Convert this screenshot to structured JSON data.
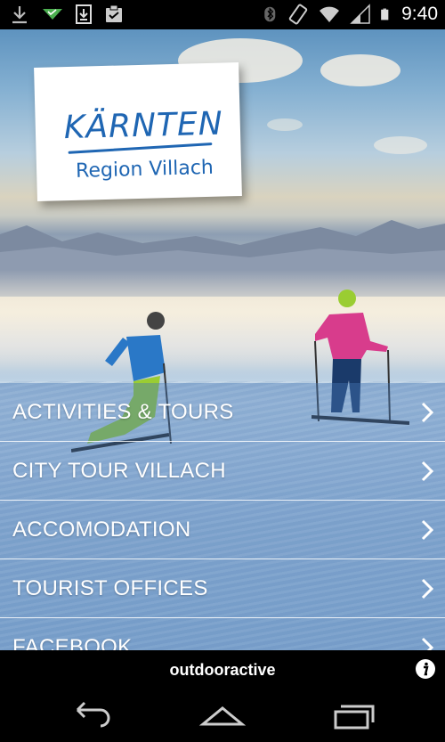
{
  "status_bar": {
    "time": "9:40",
    "left_icons": [
      "download-icon",
      "signal-check-icon",
      "download-box-icon",
      "clipboard-icon"
    ],
    "right_icons": [
      "bluetooth-icon",
      "rotate-icon",
      "wifi-icon",
      "cell-signal-icon",
      "battery-icon"
    ]
  },
  "logo": {
    "title": "KÄRNTEN",
    "subtitle": "Region Villach",
    "color": "#1f66b3"
  },
  "menu": {
    "items": [
      {
        "label": "ACTIVITIES & TOURS",
        "icon": "chevron-right-icon"
      },
      {
        "label": "CITY TOUR VILLACH",
        "icon": "chevron-right-icon"
      },
      {
        "label": "ACCOMODATION",
        "icon": "chevron-right-icon"
      },
      {
        "label": "TOURIST OFFICES",
        "icon": "chevron-right-icon"
      },
      {
        "label": "FACEBOOK",
        "icon": "chevron-right-icon"
      }
    ]
  },
  "footer": {
    "brand": "outdooractive",
    "info_icon": "info-icon"
  },
  "navbar": {
    "buttons": [
      "back-icon",
      "home-icon",
      "recents-icon"
    ]
  },
  "colors": {
    "menu_overlay": "#4678b4",
    "brand_blue": "#1f66b3",
    "bar_background": "#000000"
  }
}
